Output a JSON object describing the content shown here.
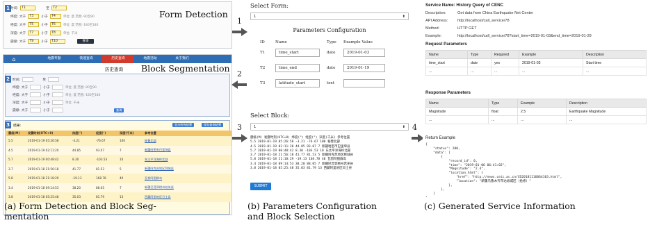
{
  "panel_a_top": {
    "title_overlay": "Form Detection",
    "badge": "1",
    "row1": {
      "label1": "时间:",
      "val1": "T1",
      "sep": "至",
      "val2": "T2"
    },
    "row2": {
      "label": "纬度: 大于",
      "v1": "T3",
      "mid": "小于",
      "v2": "T4",
      "hint": "单位: 度 范围:-90至90"
    },
    "row3": {
      "label": "经度: 大于",
      "v1": "T5",
      "mid": "小于",
      "v2": "T6",
      "hint": "单位: 度 范围:-180至180"
    },
    "row4": {
      "label": "深度: 大于",
      "v1": "T7",
      "mid": "小于",
      "v2": "T8",
      "hint": "单位: 千米"
    },
    "row5": {
      "label": "震级: 大于",
      "v1": "T9",
      "mid": "小于",
      "v2": "T10",
      "button": "查询"
    }
  },
  "panel_a_bot": {
    "nav": [
      "地震专题",
      "快速查询",
      "历史查询",
      "地震活动",
      "关于我们"
    ],
    "nav_active": 2,
    "subtitle": "历史查询",
    "title_overlay": "Block Segmentation",
    "block2": {
      "badge": "2",
      "rows": [
        {
          "label": "时间:",
          "mid": "至",
          "hint": ""
        },
        {
          "label": "纬度: 大于",
          "mid": "小于",
          "hint": "单位: 度 范围:-90至90"
        },
        {
          "label": "经度: 大于",
          "mid": "小于",
          "hint": "单位: 度 范围:-180至180"
        },
        {
          "label": "深度: 大于",
          "mid": "小于",
          "hint": "单位: 千米"
        },
        {
          "label": "震级: 大于",
          "mid": "小于",
          "hint": ""
        }
      ],
      "button": "查询"
    },
    "block3": {
      "badge": "3",
      "label": "结果:",
      "buttons": [
        "显示所有结果",
        "保存查询结果"
      ],
      "columns": [
        "震级(M)",
        "发震时刻(UTC+8)",
        "纬度(°)",
        "经度(°)",
        "深度(千米)",
        "参考位置"
      ],
      "rows": [
        [
          "5.5",
          "2019-01-19 05:26:58",
          "-3.21",
          "-76.67",
          "100",
          "秘鲁北部"
        ],
        [
          "4.5",
          "2019-01-19 02:11:20",
          "44.85",
          "93.07",
          "7",
          "新疆哈密市巴里坤县"
        ],
        [
          "5.7",
          "2019-01-19 00:48:42",
          "8.30",
          "-103.53",
          "10",
          "东太平洋海岭北部"
        ],
        [
          "3.7",
          "2019-01-18 21:56:18",
          "41.77",
          "81.53",
          "5",
          "新疆阿克苏地区拜城县"
        ],
        [
          "5.8",
          "2019-01-18 21:18:29",
          "-19.13",
          "168.78",
          "40",
          "瓦努阿图群岛"
        ],
        [
          "3.4",
          "2019-01-18 09:14:53",
          "38.20",
          "88.05",
          "7",
          "新疆巴音郭楞州若羌县"
        ],
        [
          "3.8",
          "2019-01-18 05:25:48",
          "35.03",
          "81.79",
          "13",
          "西藏阿里地区日土县"
        ]
      ]
    }
  },
  "steps": [
    "1",
    "2",
    "3",
    "4"
  ],
  "panel_b_top": {
    "select_label": "Select Form:",
    "select_value": "1",
    "heading": "Parameters Configuration",
    "columns": [
      "ID",
      "Name",
      "Type",
      "Example Value"
    ],
    "rows": [
      {
        "id": "T1",
        "name": "time_start",
        "type": "date",
        "example": "2019-01-03"
      },
      {
        "id": "T2",
        "name": "time_end",
        "type": "date",
        "example": "2019-01-19"
      },
      {
        "id": "T3",
        "name": "latitude_start",
        "type": "text",
        "example": ""
      }
    ]
  },
  "panel_b_bot": {
    "select_label": "Select Block:",
    "select_value": "1",
    "lines": [
      "震级(M) 发震时刻(UTC+8) 纬度(°) 经度(°) 深度(千米) 参考位置",
      "5.5 2019-01-19 05:26:58 -3.21 -76.67 100 秘鲁北部",
      "4.5 2019-01-19 02:11:20 44.85 93.07 7 新疆哈密市巴里坤县",
      "5.7 2019-01-19 00:48:42 8.30 -103.53 10 东太平洋海岭北部",
      "3.7 2019-01-18 21:56:18 41.77 81.53 5 新疆阿克苏地区拜城县",
      "5.8 2019-01-18 21:18:29 -19.13 168.78 40 瓦努阿图群岛",
      "3.4 2019-01-18 09:14:53 38.20 88.05 7 新疆巴音郭楞州若羌县",
      "3.8 2019-01-18 05:25:48 35.03 81.79 13 西藏阿里地区日土县"
    ],
    "submit": "SUBMIT"
  },
  "panel_c": {
    "service_name": "Service Name: History Query of CENC",
    "info": [
      {
        "k": "Description:",
        "v": "Get data from China Earthquake Net Center"
      },
      {
        "k": "API Address:",
        "v": "http://localhost/call_service/78"
      },
      {
        "k": "Method:",
        "v": "HTTP GET"
      },
      {
        "k": "Example:",
        "v": "http://localhost/call_service/78?start_time=2019-01-03&end_time=2019-01-29"
      }
    ],
    "request_title": "Request Parameters",
    "request_columns": [
      "Name",
      "Type",
      "Required",
      "Example",
      "Description"
    ],
    "request_rows": [
      [
        "time_start",
        "date",
        "yes",
        "2019-01-03",
        "Start time"
      ],
      [
        "...",
        "...",
        "...",
        "...",
        "..."
      ]
    ],
    "response_title": "Response Parameters",
    "response_columns": [
      "Name",
      "Type",
      "Example",
      "Description"
    ],
    "response_rows": [
      [
        "Magnitude",
        "float",
        "2.5",
        "Earthquake Magnitude"
      ],
      [
        "...",
        "...",
        "...",
        "..."
      ]
    ],
    "return_title": "Return Example",
    "return_lines": [
      "{",
      "    \"status\": 200,",
      "    \"data\": [",
      "        {",
      "            \"record_id\": 0,",
      "            \"time\": \"2019-01-06 06:41:02\",",
      "            \"Magnitude\": \"2.4\",",
      "            \"location_html\": {",
      "                \"href\": \"http://news.ceic.ac.cn/CD20181116064103.html\",",
      "                \"location\": \"新疆乌鲁木齐市达坂城区（抢修）\"",
      "            },",
      "        },",
      "    ]",
      "}"
    ]
  },
  "captions": {
    "a_line1": "(a) Form Detection and Block Seg-",
    "a_line2": "mentation",
    "b_line1": "(b) Parameters Configuration",
    "b_line2": "and Block Selection",
    "c_line1": "(c) Generated Service Information"
  }
}
